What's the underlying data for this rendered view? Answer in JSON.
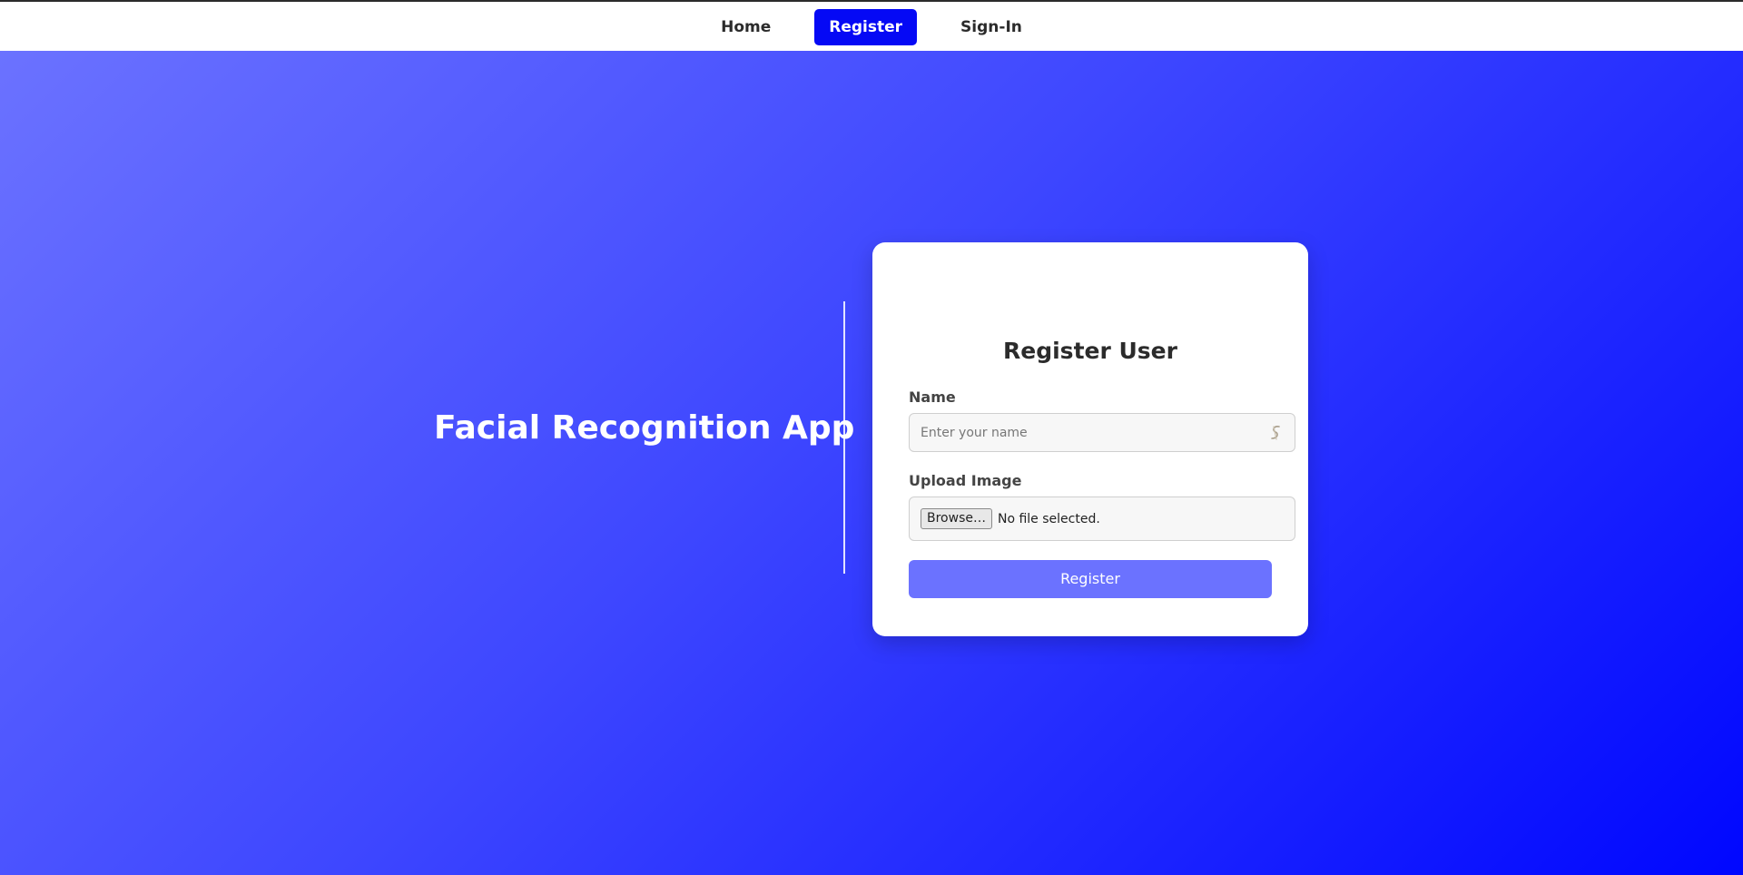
{
  "nav": {
    "items": [
      {
        "label": "Home",
        "active": false
      },
      {
        "label": "Register",
        "active": true
      },
      {
        "label": "Sign-In",
        "active": false
      }
    ]
  },
  "hero": {
    "title": "Facial Recognition App"
  },
  "form": {
    "title": "Register User",
    "name_label": "Name",
    "name_placeholder": "Enter your name",
    "name_value": "",
    "upload_label": "Upload Image",
    "browse_label": "Browse…",
    "file_status": "No file selected.",
    "submit_label": "Register"
  },
  "icons": {
    "name_input_icon": "password-manager-icon"
  },
  "colors": {
    "accent": "#0509f5",
    "button": "#6b72ff",
    "gradient_start": "#6b72ff",
    "gradient_end": "#0007ff"
  }
}
